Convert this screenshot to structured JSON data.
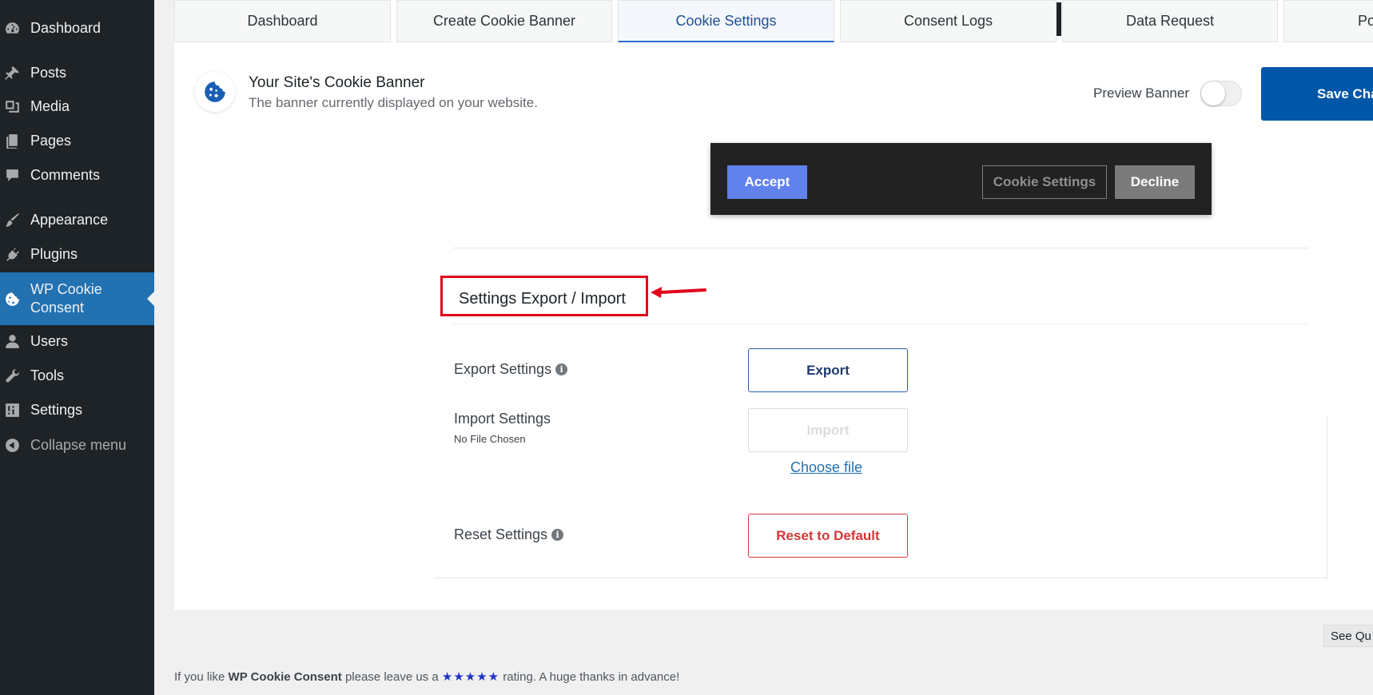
{
  "sidebar": {
    "items": [
      {
        "label": "Dashboard",
        "icon": "dashboard-icon"
      },
      {
        "label": "Posts",
        "icon": "pushpin-icon"
      },
      {
        "label": "Media",
        "icon": "media-icon"
      },
      {
        "label": "Pages",
        "icon": "pages-icon"
      },
      {
        "label": "Comments",
        "icon": "comment-icon"
      },
      {
        "label": "Appearance",
        "icon": "paintbrush-icon"
      },
      {
        "label": "Plugins",
        "icon": "plug-icon"
      },
      {
        "label": "WP Cookie Consent",
        "icon": "cookie-icon",
        "active": true
      },
      {
        "label": "Users",
        "icon": "user-icon"
      },
      {
        "label": "Tools",
        "icon": "wrench-icon"
      },
      {
        "label": "Settings",
        "icon": "sliders-icon"
      },
      {
        "label": "Collapse menu",
        "icon": "collapse-icon"
      }
    ]
  },
  "tabs": [
    "Dashboard",
    "Create Cookie Banner",
    "Cookie Settings",
    "Consent Logs",
    "Data Request",
    "Pol"
  ],
  "active_tab": "Cookie Settings",
  "header": {
    "title": "Your Site's Cookie Banner",
    "subtitle": "The banner currently displayed on your website.",
    "preview_label": "Preview Banner",
    "preview_on": false,
    "save_label": "Save Cha"
  },
  "banner": {
    "accept": "Accept",
    "settings": "Cookie Settings",
    "decline": "Decline"
  },
  "section": {
    "title": "Settings Export / Import",
    "export_label": "Export Settings",
    "export_button": "Export",
    "import_label": "Import Settings",
    "no_file": "No File Chosen",
    "import_button": "Import",
    "choose_file": "Choose file",
    "reset_label": "Reset Settings",
    "reset_button": "Reset to Default"
  },
  "see_button": "See Qu",
  "footer": {
    "prefix": "If you like ",
    "plugin": "WP Cookie Consent",
    "middle": " please leave us a ",
    "stars": "★★★★★",
    "suffix": " rating. A huge thanks in advance!"
  },
  "colors": {
    "sidebar_bg": "#1d2327",
    "sidebar_active": "#2271b1",
    "save_button": "#0056a7",
    "accept_button": "#6181ec",
    "highlight_box": "#e0001a",
    "reset_red": "#d63638"
  }
}
